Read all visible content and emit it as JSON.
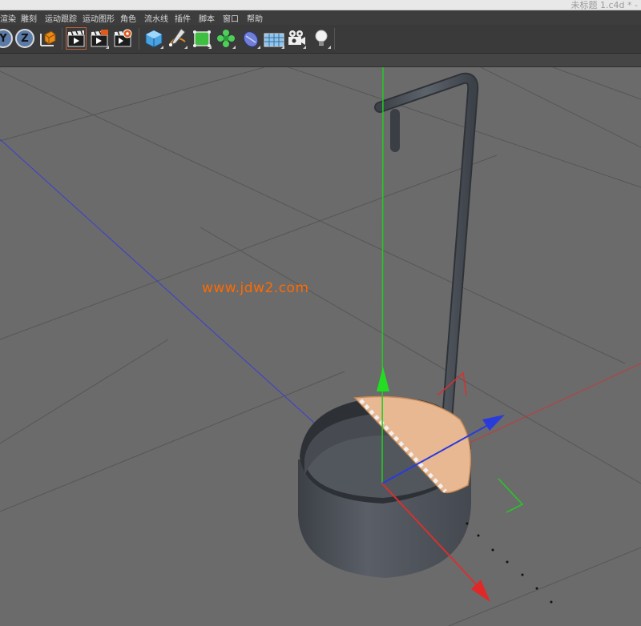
{
  "window": {
    "title": "未标题 1.c4d * -"
  },
  "menu": {
    "items": [
      "渲染",
      "雕刻",
      "运动跟踪",
      "运动图形",
      "角色",
      "流水线",
      "插件",
      "脚本",
      "窗口",
      "帮助"
    ]
  },
  "toolbar": {
    "y_label": "Y",
    "z_label": "Z",
    "tools": [
      "coordinate-system-icon",
      "render-view-icon",
      "render-to-picture-viewer-icon",
      "render-settings-icon",
      "cube-icon",
      "pen-spline-icon",
      "subdivision-surface-icon",
      "cloner-icon",
      "deformer-icon",
      "floor-icon",
      "camera-icon",
      "light-icon"
    ]
  },
  "viewport": {
    "watermark": "www.jdw2.com"
  },
  "colors": {
    "axis_x": "#d83030",
    "axis_y": "#22cc22",
    "axis_z": "#2a3bdc",
    "selected_polygon": "#e8b893",
    "object_gray": "#4d525a",
    "background": "#6b6b6b"
  }
}
